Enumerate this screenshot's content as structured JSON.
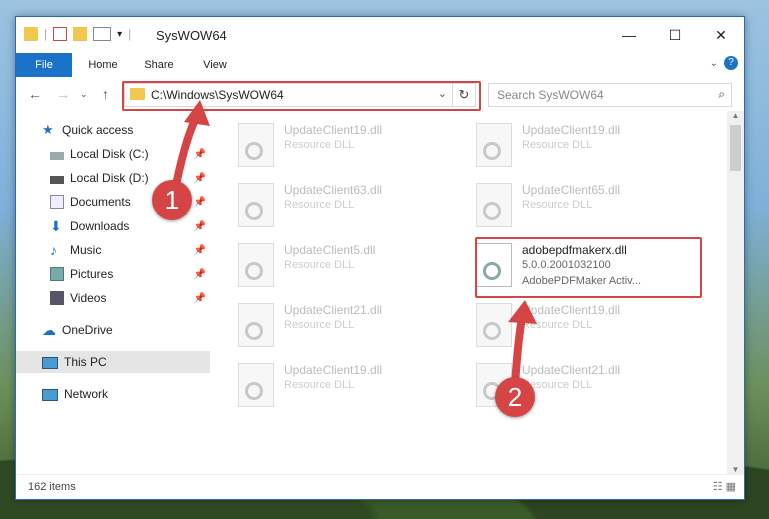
{
  "window": {
    "title": "SysWOW64"
  },
  "ribbon": {
    "tabs": [
      {
        "label": "File"
      },
      {
        "label": "Home"
      },
      {
        "label": "Share"
      },
      {
        "label": "View"
      }
    ]
  },
  "address": {
    "path": "C:\\Windows\\SysWOW64"
  },
  "search": {
    "placeholder": "Search SysWOW64"
  },
  "nav": {
    "items": [
      {
        "label": "Quick access",
        "icon": "star-icon"
      },
      {
        "label": "Local Disk (C:)",
        "icon": "drive-icon"
      },
      {
        "label": "Local Disk (D:)",
        "icon": "drive-icon"
      },
      {
        "label": "Documents",
        "icon": "documents-icon"
      },
      {
        "label": "Downloads",
        "icon": "download-icon"
      },
      {
        "label": "Music",
        "icon": "music-icon"
      },
      {
        "label": "Pictures",
        "icon": "pictures-icon"
      },
      {
        "label": "Videos",
        "icon": "videos-icon"
      },
      {
        "label": "OneDrive",
        "icon": "cloud-icon"
      },
      {
        "label": "This PC",
        "icon": "computer-icon"
      },
      {
        "label": "Network",
        "icon": "network-icon"
      }
    ]
  },
  "files": [
    {
      "name": "UpdateClient19.dll",
      "type": "Resource DLL"
    },
    {
      "name": "UpdateClient19.dll",
      "type": "Resource DLL"
    },
    {
      "name": "UpdateClient63.dll",
      "type": "Resource DLL"
    },
    {
      "name": "UpdateClient65.dll",
      "type": "Resource DLL"
    },
    {
      "name": "UpdateClient5.dll",
      "type": "Resource DLL"
    },
    {
      "name": "adobepdfmakerx.dll",
      "version": "5.0.0.2001032100",
      "desc": "AdobePDFMaker Activ..."
    },
    {
      "name": "UpdateClient21.dll",
      "type": "Resource DLL"
    },
    {
      "name": "UpdateClient19.dll",
      "type": "Resource DLL"
    },
    {
      "name": "UpdateClient19.dll",
      "type": "Resource DLL"
    },
    {
      "name": "UpdateClient21.dll",
      "type": "Resource DLL"
    }
  ],
  "status": {
    "count": "162 items"
  },
  "callouts": [
    {
      "label": "1"
    },
    {
      "label": "2"
    }
  ],
  "colors": {
    "accent": "#1a73c9",
    "callout": "#d64545"
  }
}
